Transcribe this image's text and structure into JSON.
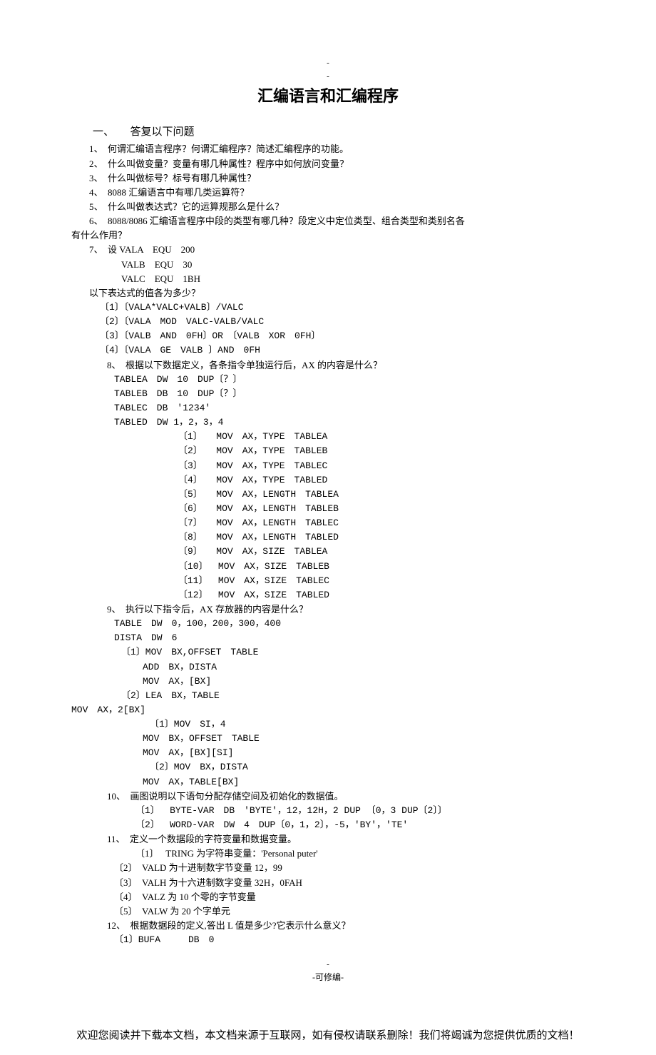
{
  "header_dash": "-",
  "header_dash2": "-",
  "title": "汇编语言和汇编程序",
  "section1": "一、　　答复以下问题",
  "q1": "1、　何谓汇编语言程序？何谓汇编程序？简述汇编程序的功能。",
  "q2": "2、　什么叫做变量？变量有哪几种属性？程序中如何放问变量？",
  "q3": "3、　什么叫做标号？标号有哪几种属性？",
  "q4": "4、　8088 汇编语言中有哪几类运算符？",
  "q5": "5、　什么叫做表达式？它的运算规那么是什么？",
  "q6": "6、　8088/8086 汇编语言程序中段的类型有哪几种？段定义中定位类型、组合类型和类别名各",
  "q6b": "有什么作用？",
  "q7": "7、　设 VALA　EQU　200",
  "q7b": "VALB　EQU　30",
  "q7c": "VALC　EQU　1BH",
  "q7d": "以下表达式的值各为多少？",
  "e1": "〔1〕〔VALA*VALC+VALB〕/VALC",
  "e2": "〔2〕〔VALA　MOD　VALC-VALB/VALC",
  "e3": "〔3〕〔VALB　AND　0FH〕OR　〔VALB　XOR　0FH〕",
  "e4": "〔4〕〔VALA　GE　VALB 〕AND　0FH",
  "q8": "8、　根据以下数据定义，各条指令单独运行后，AX 的内容是什么？",
  "t1": "TABLEA　DW　10　DUP〔？〕",
  "t2": "TABLEB　DB　10　DUP〔？〕",
  "t3": "TABLEC　DB　'1234'",
  "t4": "TABLED　DW 1，2，3，4",
  "i1": "〔1〕　　MOV　AX，TYPE　TABLEA",
  "i2": "〔2〕　　MOV　AX，TYPE　TABLEB",
  "i3": "〔3〕　　MOV　AX，TYPE　TABLEC",
  "i4": "〔4〕　　MOV　AX，TYPE　TABLED",
  "i5": "〔5〕　　MOV　AX，LENGTH　TABLEA",
  "i6": "〔6〕　　MOV　AX，LENGTH　TABLEB",
  "i7": "〔7〕　　MOV　AX，LENGTH　TABLEC",
  "i8": "〔8〕　　MOV　AX，LENGTH　TABLED",
  "i9": "〔9〕　　MOV　AX，SIZE　TABLEA",
  "i10": "〔10〕　 MOV　AX，SIZE　TABLEB",
  "i11": "〔11〕　 MOV　AX，SIZE　TABLEC",
  "i12": "〔12〕　 MOV　AX，SIZE　TABLED",
  "q9": "9、　执行以下指令后，AX 存放器的内容是什么？",
  "r1": "TABLE　DW　0，100，200，300，400",
  "r2": "DISTA　DW　6",
  "r3": "〔1〕MOV　BX,OFFSET　TABLE",
  "r4": "ADD　BX，DISTA",
  "r5": "MOV　AX，[BX]",
  "r6": "〔2〕LEA　BX，TABLE",
  "r7": "MOV　AX，2[BX]",
  "r8": "〔1〕MOV　SI，4",
  "r9": "MOV　BX，OFFSET　TABLE",
  "r10": "MOV　AX，[BX][SI]",
  "r11": "〔2〕MOV　BX，DISTA",
  "r12": "MOV　AX，TABLE[BX]",
  "q10": "10、　画图说明以下语句分配存储空间及初始化的数据值。",
  "s10a": "〔1〕　 BYTE-VAR　DB　'BYTE'，12，12H，2 DUP 〔0，3 DUP〔2〕〕",
  "s10b": "〔2〕　 WORD-VAR　DW　4　DUP〔0，1，2〕，-5，'BY'，'TE'",
  "q11": "11、　定义一个数据段的字符变量和数据变量。",
  "s11a": "〔1〕　 TRING 为字符串变量：'Personal puter'",
  "s11b": "〔2〕　VALD 为十进制数字节变量 12，99",
  "s11c": "〔3〕　VALH 为十六进制数字变量 32H，0FAH",
  "s11d": "〔4〕　VALZ 为 10 个零的字节变量",
  "s11e": "〔5〕　VALW 为 20 个字单元",
  "q12": "12、　根据数据段的定义,答出 L 值是多少?它表示什么意义？",
  "s12a": "〔1〕BUFA　　　DB　0",
  "footer_dash": "-",
  "footer_edit": "-可修编-",
  "bottom": "欢迎您阅读并下载本文档，本文档来源于互联网，如有侵权请联系删除！我们将竭诚为您提供优质的文档！"
}
